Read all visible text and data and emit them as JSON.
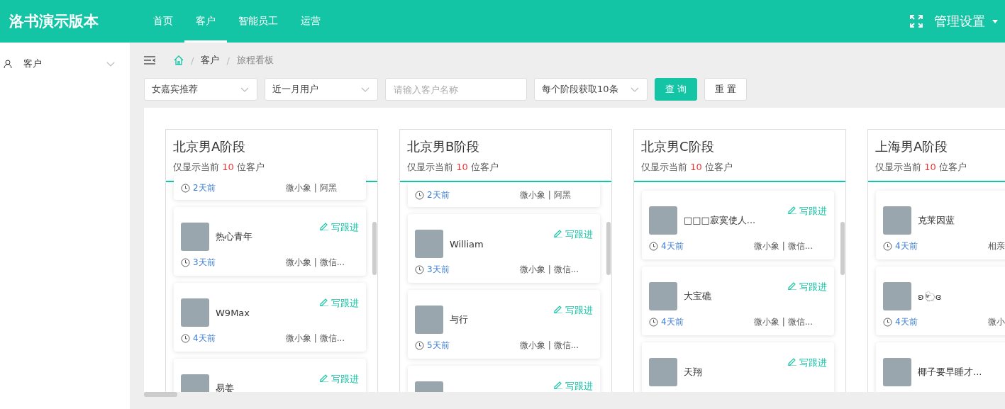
{
  "header": {
    "brand": "洛书演示版本",
    "nav": [
      {
        "label": "首页",
        "selected": false
      },
      {
        "label": "客户",
        "selected": true
      },
      {
        "label": "智能员工",
        "selected": false
      },
      {
        "label": "运营",
        "selected": false
      }
    ],
    "admin_menu": "管理设置"
  },
  "sidebar": {
    "items": [
      {
        "label": "客户",
        "expanded": false
      }
    ]
  },
  "breadcrumb": {
    "separator": "/",
    "items": [
      "客户",
      "旅程看板"
    ]
  },
  "filters": [
    {
      "kind": "select",
      "value": "女嘉宾推荐"
    },
    {
      "kind": "select",
      "value": "近一月用户"
    },
    {
      "kind": "input",
      "placeholder": "请输入客户名称"
    },
    {
      "kind": "select",
      "value": "每个阶段获取10条"
    }
  ],
  "buttons": [
    {
      "kind": "primary",
      "label": "查 询"
    },
    {
      "kind": "default",
      "label": "重 置"
    }
  ],
  "stages": [
    {
      "title": "北京男A阶段",
      "note_prefix": "仅显示当前",
      "count": "10",
      "note_suffix": "位客户",
      "cards": [
        {
          "kind": "footer",
          "time": "2天前",
          "source": "微小象 | 阿黑"
        },
        {
          "kind": "full",
          "name": "热心青年",
          "follow": "写跟进",
          "time": "3天前",
          "source": "微小象 | 微信..."
        },
        {
          "kind": "full",
          "name": "W9Max",
          "follow": "写跟进",
          "time": "4天前",
          "source": "微小象 | 微信..."
        },
        {
          "kind": "full",
          "name": "易姜",
          "follow": "写跟进"
        }
      ]
    },
    {
      "title": "北京男B阶段",
      "note_prefix": "仅显示当前",
      "count": "10",
      "note_suffix": "位客户",
      "cards": [
        {
          "kind": "footer",
          "time": "2天前",
          "source": "微小象 | 阿黑"
        },
        {
          "kind": "full",
          "name": "William",
          "follow": "写跟进",
          "time": "3天前",
          "source": "微小象 | 微信..."
        },
        {
          "kind": "full",
          "name": "与行",
          "follow": "写跟进",
          "time": "5天前",
          "source": "微小象 | 微信..."
        },
        {
          "kind": "full",
          "follow": "写跟进"
        }
      ]
    },
    {
      "title": "北京男C阶段",
      "note_prefix": "仅显示当前",
      "count": "10",
      "note_suffix": "位客户",
      "cards": [
        {
          "kind": "full",
          "name": "□□□寂寞使人...",
          "follow": "写跟进",
          "time": "4天前",
          "source": "微小象 | 微信..."
        },
        {
          "kind": "full",
          "name": "大宝礁",
          "follow": "写跟进",
          "time": "4天前",
          "source": "微小象 | 微信..."
        },
        {
          "kind": "full",
          "name": "天翔",
          "follow": "写跟进"
        }
      ]
    },
    {
      "title": "上海男A阶段",
      "note_prefix": "仅显示当前",
      "count": "10",
      "note_suffix": "位客户",
      "cards": [
        {
          "kind": "full",
          "name": "克莱因蓝",
          "time": "4天前",
          "source": "相亲"
        },
        {
          "kind": "full",
          "name": "ʚ🐑ɞ",
          "time": "4天前",
          "source": "微小"
        },
        {
          "kind": "full",
          "name": "椰子要早睡才..."
        }
      ]
    }
  ]
}
